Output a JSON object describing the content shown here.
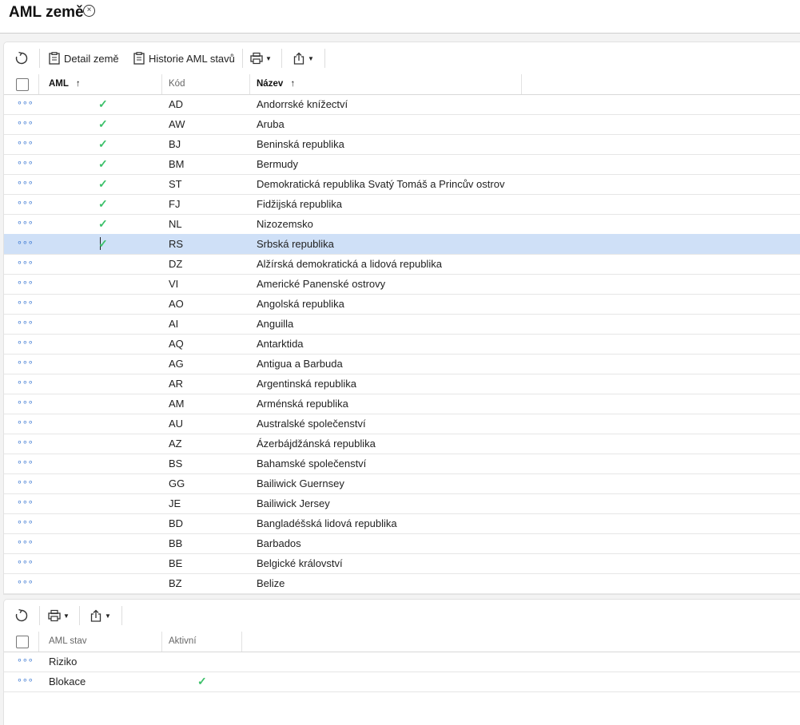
{
  "page": {
    "title": "AML země"
  },
  "toolbar1": {
    "detail_label": "Detail země",
    "history_label": "Historie AML stavů"
  },
  "grid1": {
    "headers": {
      "aml": "AML",
      "aml_sort": "↑",
      "kod": "Kód",
      "nazev": "Název",
      "nazev_sort": "↑"
    },
    "rows": [
      {
        "aml": true,
        "kod": "AD",
        "nazev": "Andorrské knížectví"
      },
      {
        "aml": true,
        "kod": "AW",
        "nazev": "Aruba"
      },
      {
        "aml": true,
        "kod": "BJ",
        "nazev": "Beninská republika"
      },
      {
        "aml": true,
        "kod": "BM",
        "nazev": "Bermudy"
      },
      {
        "aml": true,
        "kod": "ST",
        "nazev": "Demokratická republika Svatý Tomáš a Princův ostrov"
      },
      {
        "aml": true,
        "kod": "FJ",
        "nazev": "Fidžijská republika"
      },
      {
        "aml": true,
        "kod": "NL",
        "nazev": "Nizozemsko"
      },
      {
        "aml": true,
        "kod": "RS",
        "nazev": "Srbská republika",
        "selected": true
      },
      {
        "aml": false,
        "kod": "DZ",
        "nazev": "Alžírská demokratická a lidová republika"
      },
      {
        "aml": false,
        "kod": "VI",
        "nazev": "Americké Panenské ostrovy"
      },
      {
        "aml": false,
        "kod": "AO",
        "nazev": "Angolská republika"
      },
      {
        "aml": false,
        "kod": "AI",
        "nazev": "Anguilla"
      },
      {
        "aml": false,
        "kod": "AQ",
        "nazev": "Antarktida"
      },
      {
        "aml": false,
        "kod": "AG",
        "nazev": "Antigua a Barbuda"
      },
      {
        "aml": false,
        "kod": "AR",
        "nazev": "Argentinská republika"
      },
      {
        "aml": false,
        "kod": "AM",
        "nazev": "Arménská republika"
      },
      {
        "aml": false,
        "kod": "AU",
        "nazev": "Australské společenství"
      },
      {
        "aml": false,
        "kod": "AZ",
        "nazev": "Ázerbájdžánská republika"
      },
      {
        "aml": false,
        "kod": "BS",
        "nazev": "Bahamské společenství"
      },
      {
        "aml": false,
        "kod": "GG",
        "nazev": "Bailiwick Guernsey"
      },
      {
        "aml": false,
        "kod": "JE",
        "nazev": "Bailiwick Jersey"
      },
      {
        "aml": false,
        "kod": "BD",
        "nazev": "Bangladéšská lidová republika"
      },
      {
        "aml": false,
        "kod": "BB",
        "nazev": "Barbados"
      },
      {
        "aml": false,
        "kod": "BE",
        "nazev": "Belgické království"
      },
      {
        "aml": false,
        "kod": "BZ",
        "nazev": "Belize"
      }
    ]
  },
  "grid2": {
    "headers": {
      "aml_stav": "AML stav",
      "aktivni": "Aktivní"
    },
    "rows": [
      {
        "aml_stav": "Riziko",
        "aktivni": false
      },
      {
        "aml_stav": "Blokace",
        "aktivni": true
      }
    ]
  },
  "colors": {
    "accent": "#2f6fcf",
    "check": "#3cc06a",
    "selected_row": "#cfe0f7"
  }
}
